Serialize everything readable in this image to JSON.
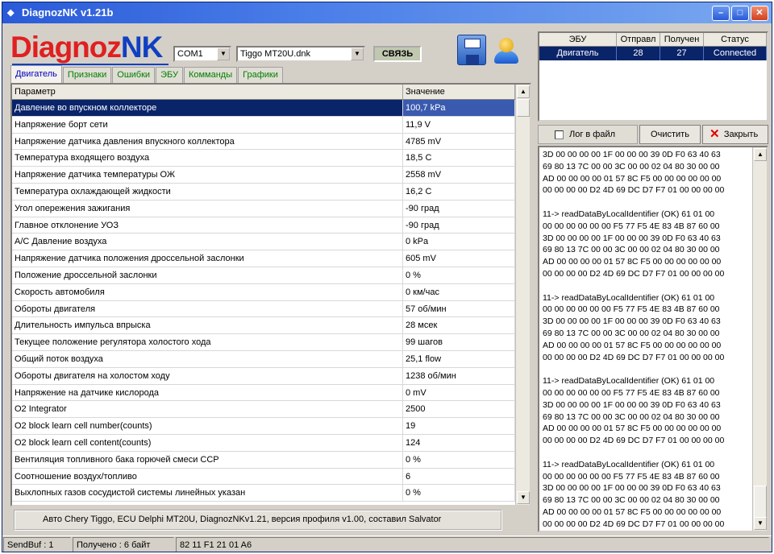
{
  "window": {
    "title": "DiagnozNK v1.21b",
    "min_label": "–",
    "max_label": "□",
    "close_label": "✕"
  },
  "toolbar": {
    "logo_part1": "Diagnoz",
    "logo_part2": "NK",
    "port_value": "COM1",
    "profile_value": "Tiggo MT20U.dnk",
    "connect_label": "СВЯЗЬ",
    "save_icon": "floppy-disk-icon",
    "user_icon": "user-icon"
  },
  "tabs": [
    "Двигатель",
    "Признаки",
    "Ошибки",
    "ЭБУ",
    "Комманды",
    "Графики"
  ],
  "grid": {
    "header_param": "Параметр",
    "header_value": "Значение",
    "rows": [
      [
        "Давление во впускном коллекторе",
        "100,7 kPa"
      ],
      [
        "Напряжение борт сети",
        "11,9 V"
      ],
      [
        "Напряжение датчика давления впускного коллектора",
        "4785 mV"
      ],
      [
        "Температура входящего воздуха",
        "18,5 C"
      ],
      [
        "Напряжение датчика температуры ОЖ",
        "2558 mV"
      ],
      [
        "Температура охлаждающей жидкости",
        "16,2 C"
      ],
      [
        "Угол опережения зажигания",
        "-90 град"
      ],
      [
        "Главное отклонение УОЗ",
        "-90 град"
      ],
      [
        "А/С Давление воздуха",
        "0 kPa"
      ],
      [
        "Напряжение датчика положения дроссельной заслонки",
        "605 mV"
      ],
      [
        "Положение дроссельной заслонки",
        "0 %"
      ],
      [
        "Скорость автомобиля",
        "0 км/час"
      ],
      [
        "Обороты двигателя",
        "57 об/мин"
      ],
      [
        "Длительность импульса впрыска",
        "28 мсек"
      ],
      [
        "Текущее положение регулятора холостого хода",
        "99 шагов"
      ],
      [
        "Общий поток воздуха",
        "25,1 flow"
      ],
      [
        "Обороты двигателя на холостом ходу",
        "1238 об/мин"
      ],
      [
        "Напряжение на датчике кислорода",
        "0 mV"
      ],
      [
        "O2 Integrator",
        "2500"
      ],
      [
        "O2 block learn cell number(counts)",
        "19"
      ],
      [
        "O2 block learn cell content(counts)",
        "124"
      ],
      [
        "Вентиляция топливного бака горючей смеси CCP",
        "0 %"
      ],
      [
        "Соотношение воздух/топливо",
        "6"
      ],
      [
        "Выхлопных газов сосудистой системы линейных указан",
        "0 %"
      ]
    ]
  },
  "footer_info": "Авто Chery Tiggo,  ECU Delphi MT20U,  DiagnozNKv1.21,  версия профиля v1.00,  составил Salvator",
  "ecu": {
    "headers": [
      "ЭБУ",
      "Отправл",
      "Получен",
      "Статус"
    ],
    "row": [
      "Двигатель",
      "28",
      "27",
      "Connected"
    ]
  },
  "log": {
    "checkbox_label": "Лог в файл",
    "clear_label": "Очистить",
    "close_label": "Закрыть",
    "text": "3D 00 00 00 00 1F 00 00 00 39 0D F0 63 40 63\n69 80 13 7C 00 00 3C 00 00 02 04 80 30 00 00\nAD 00 00 00 00 01 57 8C F5 00 00 00 00 00 00\n00 00 00 00 D2 4D 69 DC D7 F7 01 00 00 00 00\n\n11-> readDataByLocalIdentifier (OK) 61 01 00\n00 00 00 00 00 00 F5 77 F5 4E 83 4B 87 60 00\n3D 00 00 00 00 1F 00 00 00 39 0D F0 63 40 63\n69 80 13 7C 00 00 3C 00 00 02 04 80 30 00 00\nAD 00 00 00 00 01 57 8C F5 00 00 00 00 00 00\n00 00 00 00 D2 4D 69 DC D7 F7 01 00 00 00 00\n\n11-> readDataByLocalIdentifier (OK) 61 01 00\n00 00 00 00 00 00 F5 77 F5 4E 83 4B 87 60 00\n3D 00 00 00 00 1F 00 00 00 39 0D F0 63 40 63\n69 80 13 7C 00 00 3C 00 00 02 04 80 30 00 00\nAD 00 00 00 00 01 57 8C F5 00 00 00 00 00 00\n00 00 00 00 D2 4D 69 DC D7 F7 01 00 00 00 00\n\n11-> readDataByLocalIdentifier (OK) 61 01 00\n00 00 00 00 00 00 F5 77 F5 4E 83 4B 87 60 00\n3D 00 00 00 00 1F 00 00 00 39 0D F0 63 40 63\n69 80 13 7C 00 00 3C 00 00 02 04 80 30 00 00\nAD 00 00 00 00 01 57 8C F5 00 00 00 00 00 00\n00 00 00 00 D2 4D 69 DC D7 F7 01 00 00 00 00\n\n11-> readDataByLocalIdentifier (OK) 61 01 00\n00 00 00 00 00 00 F5 77 F5 4E 83 4B 87 60 00\n3D 00 00 00 00 1F 00 00 00 39 0D F0 63 40 63\n69 80 13 7C 00 00 3C 00 00 02 04 80 30 00 00\nAD 00 00 00 00 01 57 8C F5 00 00 00 00 00 00\n00 00 00 00 D2 4D 69 DC D7 F7 01 00 00 00 00"
  },
  "status": {
    "sendbuf": "SendBuf : 1",
    "received": "Получено : 6 байт",
    "bytes": "82 11 F1 21 01 A6"
  }
}
